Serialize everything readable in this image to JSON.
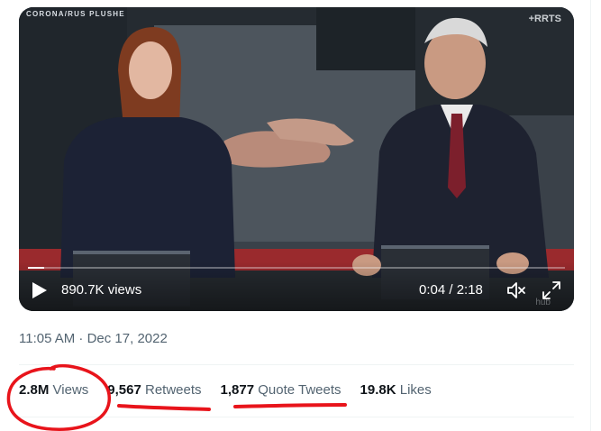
{
  "video": {
    "channel_tag": "CORONA/RUS PLUSHE",
    "watermark": "+RRTS",
    "bottom_watermark": "hub",
    "view_count": "890.7K views",
    "timecode": "0:04 / 2:18",
    "progress_fraction": 0.03
  },
  "tweet": {
    "timestamp": "11:05 AM · Dec 17, 2022"
  },
  "stats": {
    "views": {
      "value": "2.8M",
      "label": "Views"
    },
    "retweets": {
      "value": "9,567",
      "label": "Retweets"
    },
    "quotes": {
      "value": "1,877",
      "label": "Quote Tweets"
    },
    "likes": {
      "value": "19.8K",
      "label": "Likes"
    }
  },
  "colors": {
    "annotation": "#e8141b",
    "secondary_text": "#536471",
    "primary_text": "#0f1419"
  }
}
